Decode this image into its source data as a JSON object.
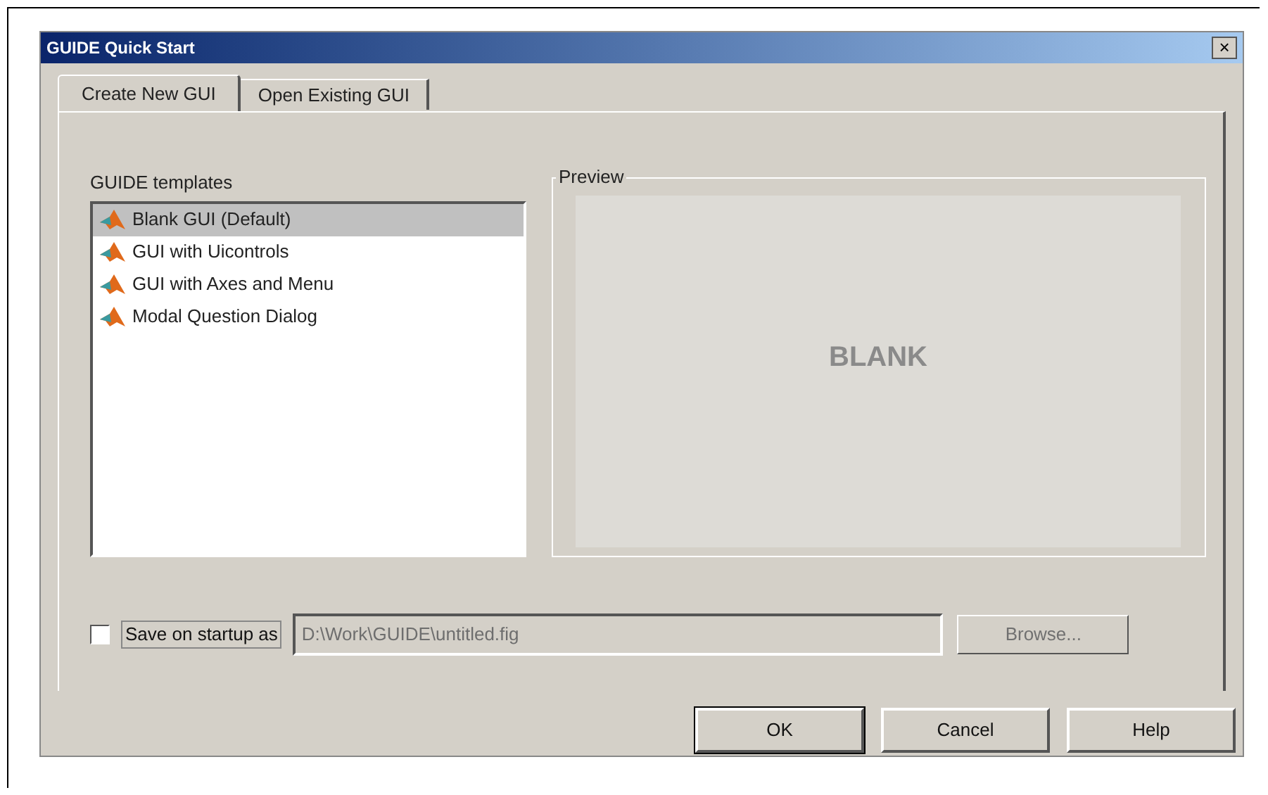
{
  "window": {
    "title": "GUIDE Quick Start",
    "close": "×"
  },
  "tabs": [
    {
      "label": "Create New GUI",
      "selected": true
    },
    {
      "label": "Open Existing GUI",
      "selected": false
    }
  ],
  "templates": {
    "label": "GUIDE templates",
    "items": [
      {
        "label": "Blank GUI (Default)",
        "selected": true
      },
      {
        "label": "GUI with Uicontrols",
        "selected": false
      },
      {
        "label": "GUI with Axes and Menu",
        "selected": false
      },
      {
        "label": "Modal Question Dialog",
        "selected": false
      }
    ]
  },
  "preview": {
    "label": "Preview",
    "text": "BLANK"
  },
  "save": {
    "label": "Save on startup as",
    "checked": false,
    "value": "D:\\Work\\GUIDE\\untitled.fig",
    "disabled": true,
    "browse": "Browse...",
    "browse_disabled": true
  },
  "buttons": [
    "OK",
    "Cancel",
    "Help"
  ]
}
